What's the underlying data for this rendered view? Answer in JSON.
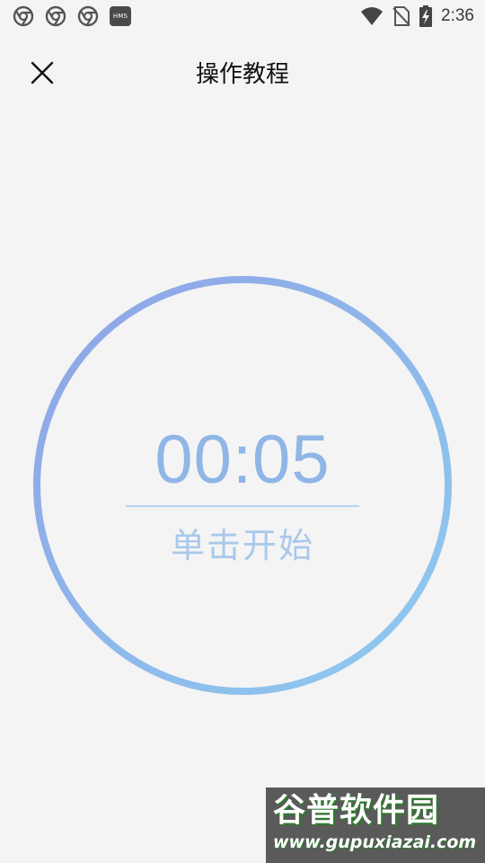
{
  "status_bar": {
    "left_icons": [
      "chrome-icon",
      "chrome-icon",
      "chrome-icon",
      "hms-icon"
    ],
    "hms_label": "HMS",
    "right_icons": [
      "wifi-icon",
      "no-sim-icon",
      "battery-charging-icon"
    ],
    "time": "2:36"
  },
  "header": {
    "close_icon": "close-icon",
    "title": "操作教程"
  },
  "timer": {
    "time": "00:05",
    "start_label": "单击开始",
    "colors": {
      "ring_start": "#8fa3e6",
      "ring_end": "#8ecbef",
      "text": "#8fb6e6"
    }
  },
  "watermark": {
    "logo_text": "谷普软件园",
    "url": "www.gupuxiazai.com"
  }
}
